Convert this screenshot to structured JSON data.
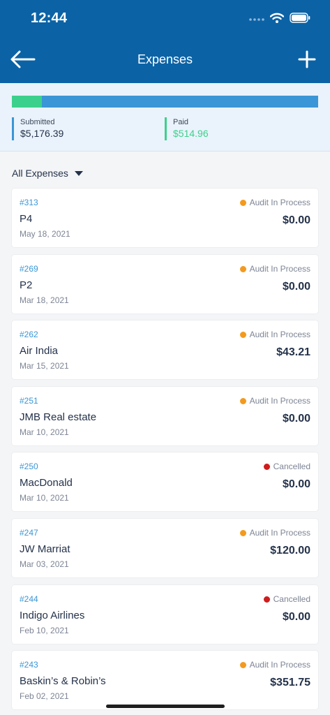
{
  "status_bar": {
    "time": "12:44"
  },
  "nav": {
    "title": "Expenses",
    "back_icon": "arrow-left-icon",
    "add_icon": "plus-icon"
  },
  "summary": {
    "progress_paid_fraction": 0.099,
    "submitted_label": "Submitted",
    "submitted_value": "$5,176.39",
    "paid_label": "Paid",
    "paid_value": "$514.96"
  },
  "filter": {
    "label": "All Expenses"
  },
  "colors": {
    "header": "#0b63a6",
    "accent_blue": "#3a96d6",
    "paid_green": "#3bd18c",
    "audit_orange": "#f39a1e",
    "cancelled_red": "#d01c1c"
  },
  "expenses": [
    {
      "id": "#313",
      "name": "P4",
      "date": "May 18, 2021",
      "status": "Audit In Process",
      "status_color": "#f39a1e",
      "amount": "$0.00"
    },
    {
      "id": "#269",
      "name": "P2",
      "date": "Mar 18, 2021",
      "status": "Audit In Process",
      "status_color": "#f39a1e",
      "amount": "$0.00"
    },
    {
      "id": "#262",
      "name": "Air India",
      "date": "Mar 15, 2021",
      "status": "Audit In Process",
      "status_color": "#f39a1e",
      "amount": "$43.21"
    },
    {
      "id": "#251",
      "name": "JMB Real estate",
      "date": "Mar 10, 2021",
      "status": "Audit In Process",
      "status_color": "#f39a1e",
      "amount": "$0.00"
    },
    {
      "id": "#250",
      "name": "MacDonald",
      "date": "Mar 10, 2021",
      "status": "Cancelled",
      "status_color": "#d01c1c",
      "amount": "$0.00"
    },
    {
      "id": "#247",
      "name": "JW Marriat",
      "date": "Mar 03, 2021",
      "status": "Audit In Process",
      "status_color": "#f39a1e",
      "amount": "$120.00"
    },
    {
      "id": "#244",
      "name": "Indigo Airlines",
      "date": "Feb 10, 2021",
      "status": "Cancelled",
      "status_color": "#d01c1c",
      "amount": "$0.00"
    },
    {
      "id": "#243",
      "name": "Baskin’s & Robin’s",
      "date": "Feb 02, 2021",
      "status": "Audit In Process",
      "status_color": "#f39a1e",
      "amount": "$351.75"
    }
  ]
}
